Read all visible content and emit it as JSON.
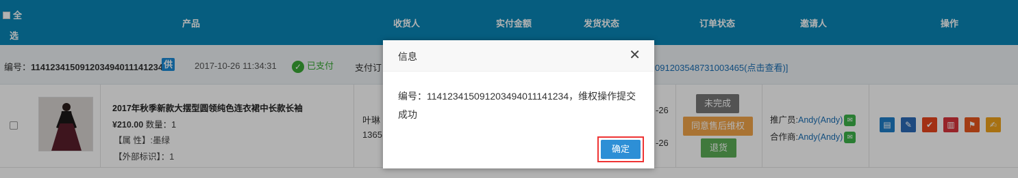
{
  "header": {
    "select_all_1": "全",
    "select_all_2": "选",
    "columns": {
      "product": "产品",
      "receiver": "收货人",
      "paid_amount": "实付金额",
      "ship_status": "发货状态",
      "order_status": "订单状态",
      "inviter": "邀请人",
      "actions": "操作"
    }
  },
  "order": {
    "no_label": "编号：",
    "no_value": "114123415091203494011141234",
    "gong_badge": "供",
    "date": "2017-10-26 11:34:31",
    "paid_text": "已支付",
    "pay_label": "支付订",
    "pay_link_tail": "09120354873100346​5(点击查看)]"
  },
  "product": {
    "name": "2017年秋季新款大摆型圆领纯色连衣裙中长款长袖",
    "price": "¥210.00",
    "qty": "数量：1",
    "attr_color": "【属 性】:墨绿",
    "attr_ext": "【外部标识】：1",
    "receiver_name": "叶琳",
    "receiver_phone": "1365",
    "date_1": "-26",
    "date_2": "-26"
  },
  "status_buttons": {
    "incomplete": "未完成",
    "agree_after_sale": "同意售后维权",
    "return": "退货"
  },
  "inviter": {
    "promo_label": "推广员:",
    "promo_name": "Andy(Andy)",
    "partner_label": "合作商:",
    "partner_name": "Andy(Andy)"
  },
  "dialog": {
    "title": "信息",
    "close_glyph": "✕",
    "message": "编号：114123415091203494011141234，维权操作提交成功",
    "confirm": "确定"
  },
  "colors": {
    "header_bg": "#0a86b6",
    "info_bg": "#eef2f5",
    "confirm_bg": "#2d8fd6",
    "highlight": "#e33333"
  }
}
